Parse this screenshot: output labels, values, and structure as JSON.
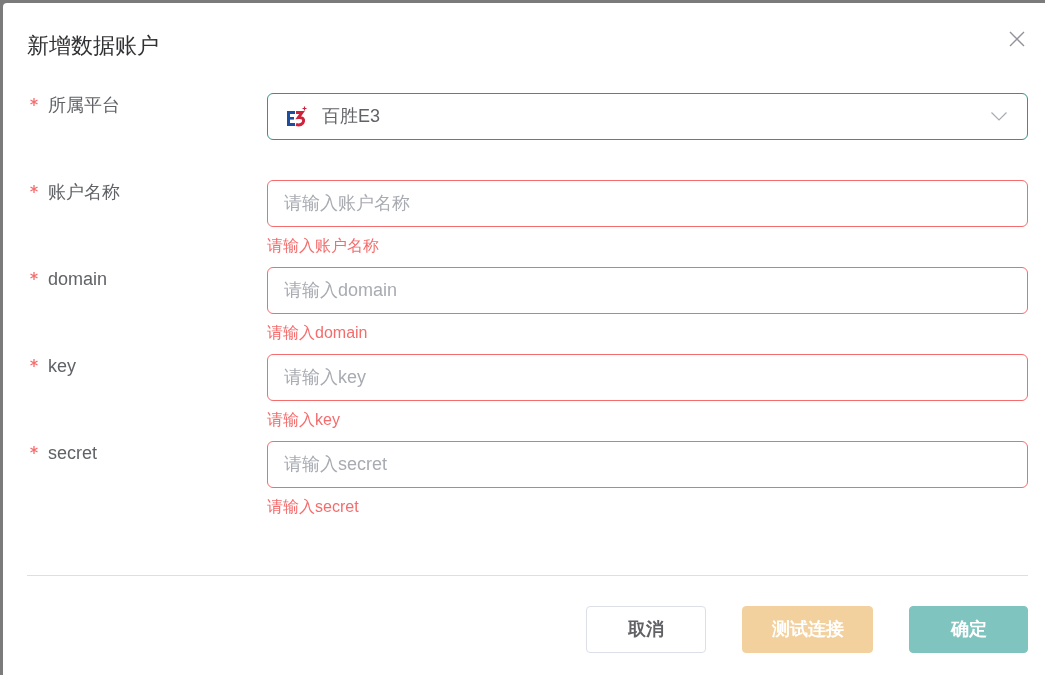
{
  "dialog": {
    "title": "新增数据账户"
  },
  "fields": [
    {
      "kind": "select",
      "label": "所属平台",
      "required": true,
      "focused": true,
      "value": "百胜E3"
    },
    {
      "kind": "input",
      "label": "账户名称",
      "required": true,
      "focused": false,
      "placeholder": "请输入账户名称",
      "error": "请输入账户名称"
    },
    {
      "kind": "input",
      "label": "domain",
      "required": true,
      "focused": false,
      "placeholder": "请输入domain",
      "error": "请输入domain"
    },
    {
      "kind": "input",
      "label": "key",
      "required": true,
      "focused": false,
      "placeholder": "请输入key",
      "error": "请输入key"
    },
    {
      "kind": "input",
      "label": "secret",
      "required": true,
      "focused": false,
      "placeholder": "请输入secret",
      "error": "请输入secret"
    }
  ],
  "buttons": [
    {
      "label": "取消",
      "kind": "default",
      "disabled": false
    },
    {
      "label": "测试连接",
      "kind": "warning",
      "disabled": true
    },
    {
      "label": "确定",
      "kind": "primary",
      "disabled": true
    }
  ]
}
